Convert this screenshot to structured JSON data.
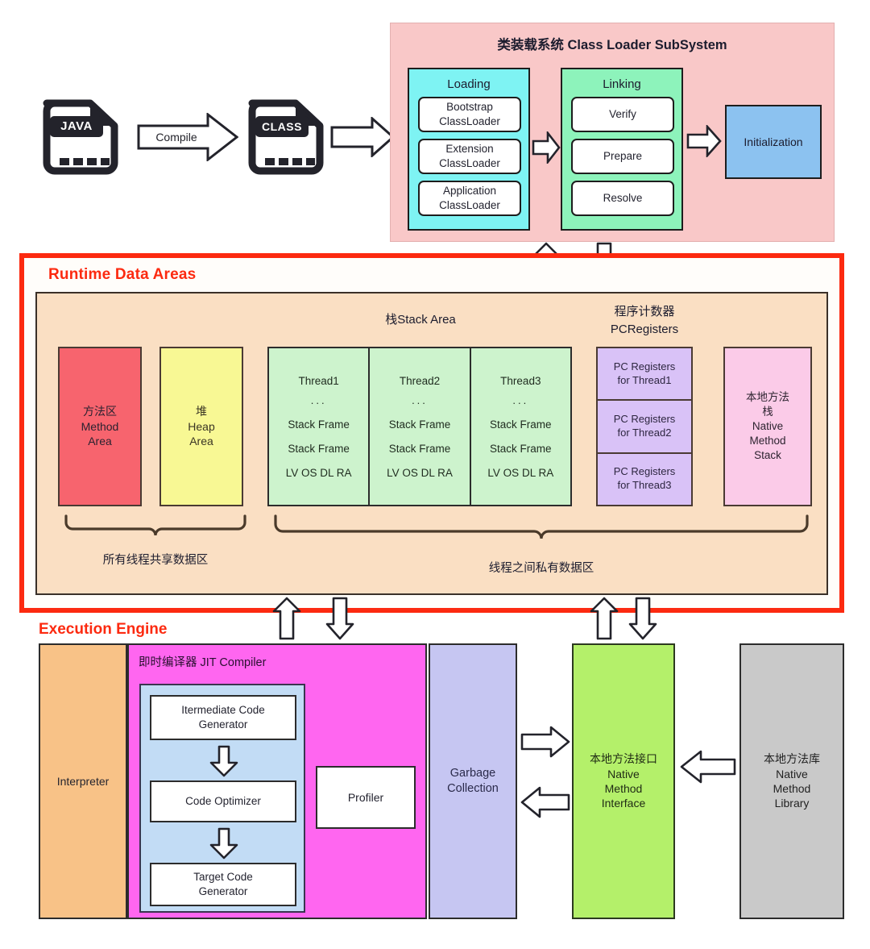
{
  "pipeline": {
    "source_file_label": "JAVA",
    "compiled_file_label": "CLASS",
    "compile_label": "Compile"
  },
  "class_loader": {
    "title": "类装载系统 Class Loader SubSystem",
    "loading": {
      "title": "Loading",
      "items": [
        "Bootstrap\nClassLoader",
        "Extension\nClassLoader",
        "Application\nClassLoader"
      ],
      "item0_line1": "Bootstrap",
      "item0_line2": "ClassLoader",
      "item1_line1": "Extension",
      "item1_line2": "ClassLoader",
      "item2_line1": "Application",
      "item2_line2": "ClassLoader"
    },
    "linking": {
      "title": "Linking",
      "items": [
        "Verify",
        "Prepare",
        "Resolve"
      ],
      "item0": "Verify",
      "item1": "Prepare",
      "item2": "Resolve"
    },
    "initialization": "Initialization"
  },
  "runtime_data_areas": {
    "title": "Runtime Data Areas",
    "stack_area_header": "栈Stack Area",
    "pc_registers_header_cn": "程序计数器",
    "pc_registers_header_en": "PCRegisters",
    "method_area": {
      "cn": "方法区",
      "en_line1": "Method",
      "en_line2": "Area"
    },
    "heap_area": {
      "cn": "堆",
      "en_line1": "Heap",
      "en_line2": "Area"
    },
    "threads": [
      {
        "name": "Thread1",
        "dots": "...",
        "frame1": "Stack Frame",
        "frame2": "Stack Frame",
        "slots": "LV OS DL RA"
      },
      {
        "name": "Thread2",
        "dots": "...",
        "frame1": "Stack Frame",
        "frame2": "Stack Frame",
        "slots": "LV OS DL RA"
      },
      {
        "name": "Thread3",
        "dots": "...",
        "frame1": "Stack Frame",
        "frame2": "Stack Frame",
        "slots": "LV OS DL RA"
      }
    ],
    "pc_registers": [
      "PC Registers\nfor Thread1",
      "PC Registers\nfor Thread2",
      "PC Registers\nfor Thread3"
    ],
    "pc0_l1": "PC Registers",
    "pc0_l2": "for Thread1",
    "pc1_l1": "PC Registers",
    "pc1_l2": "for Thread2",
    "pc2_l1": "PC Registers",
    "pc2_l2": "for Thread3",
    "native_method_stack": {
      "cn_line1": "本地方法",
      "cn_line2": "栈",
      "en_line1": "Native",
      "en_line2": "Method",
      "en_line3": "Stack"
    },
    "shared_caption": "所有线程共享数据区",
    "private_caption": "线程之间私有数据区"
  },
  "execution_engine": {
    "title": "Execution Engine",
    "interpreter": "Interpreter",
    "jit_title": "即时编译器 JIT Compiler",
    "jit_steps": [
      "Itermediate Code\nGenerator",
      "Code Optimizer",
      "Target Code\nGenerator"
    ],
    "jit_step0_l1": "Itermediate Code",
    "jit_step0_l2": "Generator",
    "jit_step1": "Code Optimizer",
    "jit_step2_l1": "Target Code",
    "jit_step2_l2": "Generator",
    "profiler": "Profiler",
    "garbage_collection_l1": "Garbage",
    "garbage_collection_l2": "Collection",
    "native_method_interface": {
      "cn": "本地方法接口",
      "en_line1": "Native",
      "en_line2": "Method",
      "en_line3": "Interface"
    },
    "native_method_library": {
      "cn": "本地方法库",
      "en_line1": "Native",
      "en_line2": "Method",
      "en_line3": "Library"
    }
  },
  "colors": {
    "class_loader_bg": "#f9c8c8",
    "loading_bg": "#7ef3f3",
    "linking_bg": "#8df3bb",
    "initialization_bg": "#8cc2f0",
    "runtime_border": "#fc2a10",
    "runtime_panel_bg": "#fadfc3",
    "method_area_bg": "#f7646e",
    "heap_bg": "#f8f894",
    "stack_bg": "#cdf3cd",
    "pc_bg": "#d9c2f7",
    "native_stack_bg": "#fbcbe8",
    "interpreter_bg": "#f8c287",
    "jit_bg": "#ff66f0",
    "jit_inner_bg": "#c2dcf5",
    "gc_bg": "#c6c6f2",
    "nmi_bg": "#b4f06a",
    "nml_bg": "#c9c9c9"
  }
}
